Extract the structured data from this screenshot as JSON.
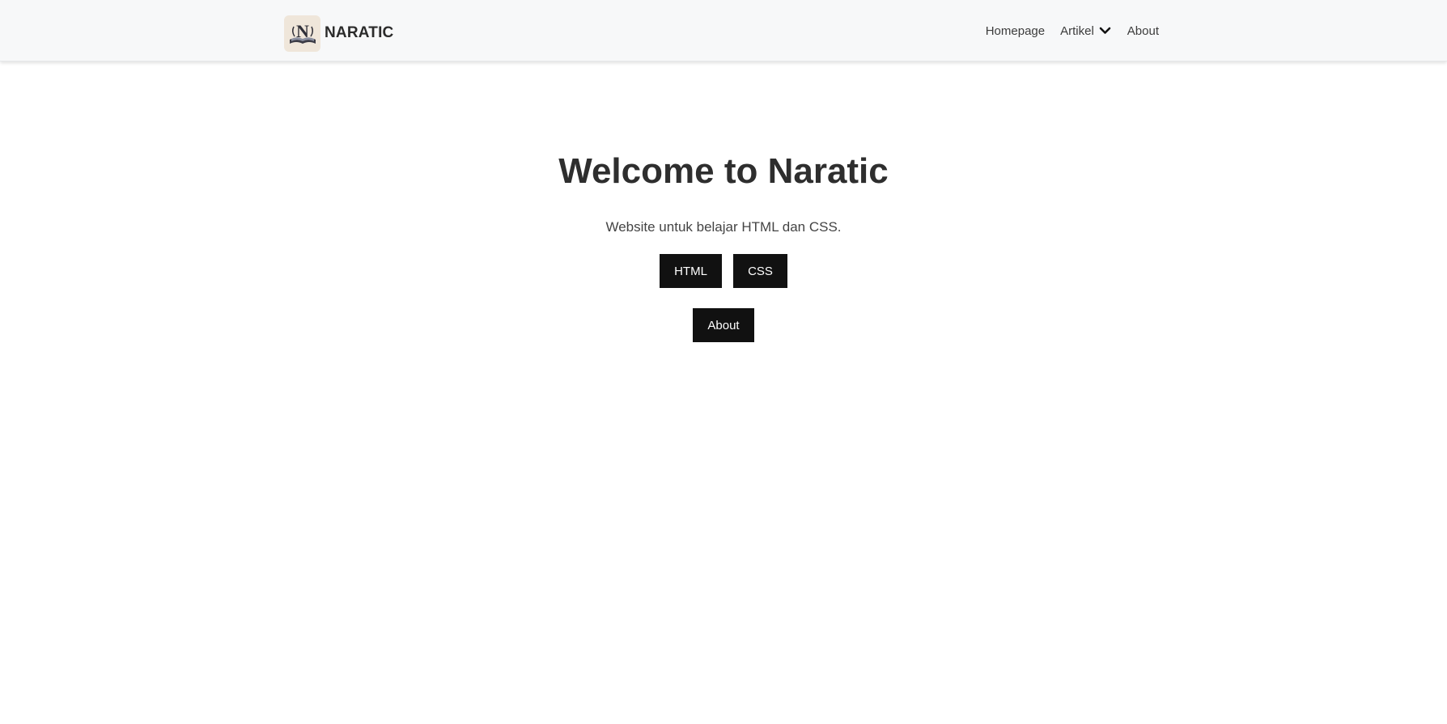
{
  "navbar": {
    "brand_name": "NARATIC",
    "logo_icon": "book-letter-n-logo",
    "links": {
      "homepage": "Homepage",
      "artikel": "Artikel",
      "about": "About"
    }
  },
  "hero": {
    "title": "Welcome to Naratic",
    "subtitle": "Website untuk belajar HTML dan CSS.",
    "buttons": {
      "html": "HTML",
      "css": "CSS",
      "about": "About"
    }
  },
  "colors": {
    "navbar_bg": "#f7f8f9",
    "button_bg": "#111111",
    "button_text": "#ffffff",
    "title_text": "#2e2e2e"
  }
}
